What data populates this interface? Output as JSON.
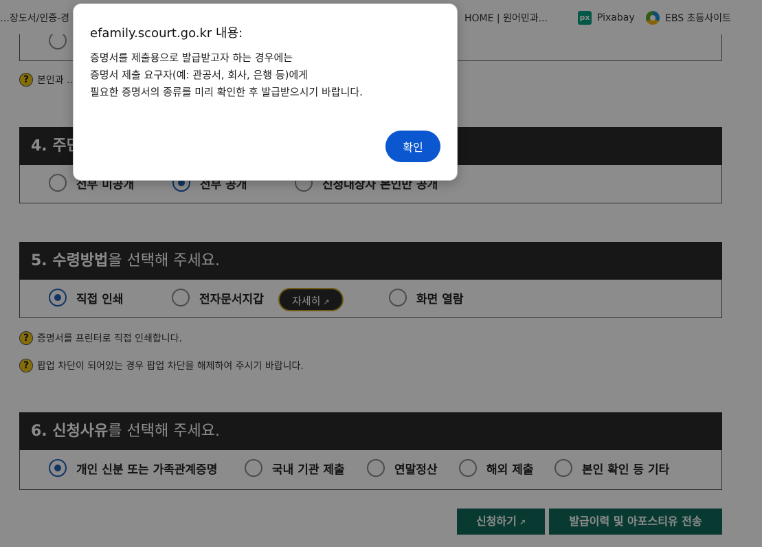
{
  "bookmarks": {
    "item_1": "…장도서/인증-경",
    "item_2": "HOME | 원어민과...",
    "pixabay": "Pixabay",
    "pixabay_icon": "px",
    "ebs": "EBS 초등사이트"
  },
  "top_note": "본인과 …",
  "section4": {
    "title_num": "4. 주민",
    "options": [
      "전부 미공개",
      "전부 공개",
      "신청대상자 본인만 공개"
    ]
  },
  "section5": {
    "title_bold": "5. 수령방법",
    "title_rest": "을 선택해 주세요.",
    "options": [
      "직접 인쇄",
      "전자문서지갑",
      "화면 열람"
    ],
    "detail_button": "자세히"
  },
  "notes5": [
    "증명서를 프린터로 직접 인쇄합니다.",
    "팝업 차단이 되어있는 경우 팝업 차단을 해제하여 주시기 바랍니다."
  ],
  "section6": {
    "title_bold": "6. 신청사유",
    "title_rest": "를 선택해 주세요.",
    "options": [
      "개인 신분 또는 가족관계증명",
      "국내 기관 제출",
      "연말정산",
      "해외 제출",
      "본인 확인 등 기타"
    ]
  },
  "actions": {
    "apply": "신청하기",
    "history": "발급이력 및 아포스티유 전송"
  },
  "dialog": {
    "title": "efamily.scourt.go.kr 내용:",
    "lines": [
      "증명서를 제출용으로 발급받고자 하는 경우에는",
      "증명서 제출 요구자(예: 관공서, 회사, 은행 등)에게",
      "필요한 증명서의 종류를 미리 확인한 후 발급받으시기 바랍니다."
    ],
    "ok": "확인"
  },
  "colors": {
    "section_header": "#2b2b2b",
    "radio_checked": "#1e5fb8",
    "action_button": "#116b5b",
    "dialog_ok": "#0b57d0"
  }
}
